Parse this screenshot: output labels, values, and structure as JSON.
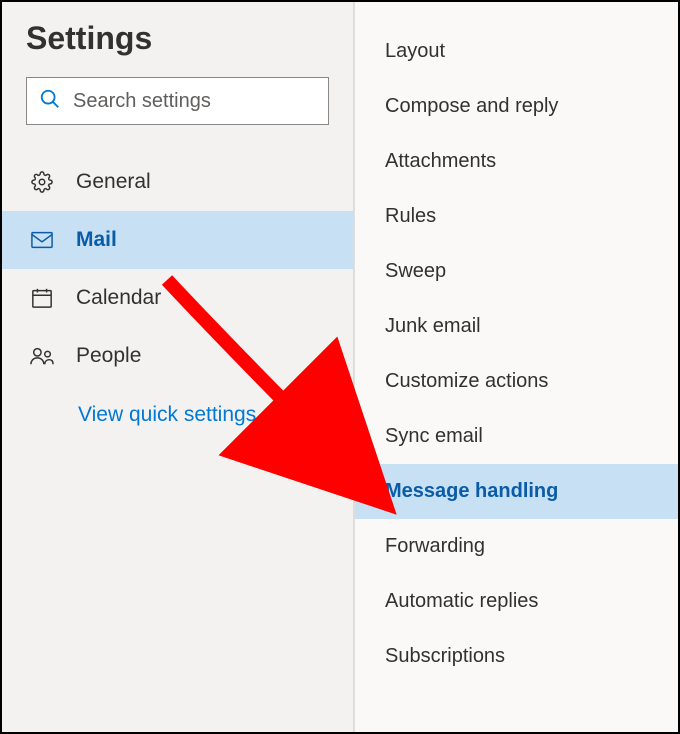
{
  "title": "Settings",
  "search": {
    "placeholder": "Search settings"
  },
  "nav": [
    {
      "id": "general",
      "label": "General",
      "icon": "gear",
      "selected": false
    },
    {
      "id": "mail",
      "label": "Mail",
      "icon": "mail",
      "selected": true
    },
    {
      "id": "calendar",
      "label": "Calendar",
      "icon": "calendar",
      "selected": false
    },
    {
      "id": "people",
      "label": "People",
      "icon": "people",
      "selected": false
    }
  ],
  "quick_link": "View quick settings",
  "sub_items": [
    {
      "label": "Layout",
      "selected": false
    },
    {
      "label": "Compose and reply",
      "selected": false
    },
    {
      "label": "Attachments",
      "selected": false
    },
    {
      "label": "Rules",
      "selected": false
    },
    {
      "label": "Sweep",
      "selected": false
    },
    {
      "label": "Junk email",
      "selected": false
    },
    {
      "label": "Customize actions",
      "selected": false
    },
    {
      "label": "Sync email",
      "selected": false
    },
    {
      "label": "Message handling",
      "selected": true
    },
    {
      "label": "Forwarding",
      "selected": false
    },
    {
      "label": "Automatic replies",
      "selected": false
    },
    {
      "label": "Subscriptions",
      "selected": false
    }
  ],
  "colors": {
    "accent": "#0078d4",
    "selected_bg": "#c7e0f4",
    "selected_fg": "#0a5ca8",
    "annotation": "#ff0000"
  }
}
